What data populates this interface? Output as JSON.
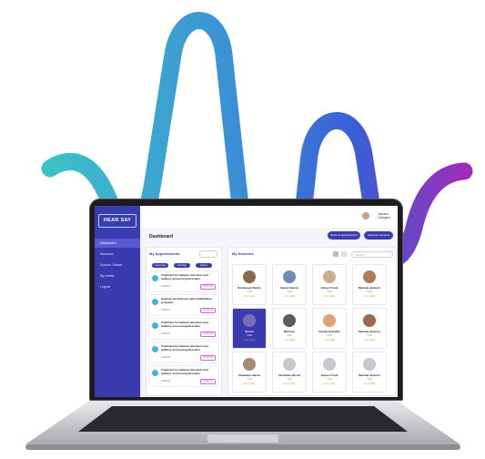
{
  "brand": {
    "logo": "HEAR SAY"
  },
  "sidebar": {
    "items": [
      "Dashboard",
      "Sessions",
      "Speech Trainer",
      "My profile",
      "Logout"
    ]
  },
  "header": {
    "title": "Dashboard",
    "user_name": "Jackson",
    "user_role": "Caregiver"
  },
  "actions": {
    "book": "Book an appointment",
    "add": "Add new account"
  },
  "appointments": {
    "title": "My Appointments",
    "tabs": [
      "Upcoming",
      "Pending",
      "History"
    ],
    "items": [
      {
        "text": "Treatment for balance disorders and auditory processing disorders",
        "date": "01/05/23",
        "status": "Confirmed"
      },
      {
        "text": "Hearing aid dispense and rehabilitation programs",
        "date": "01/05/23",
        "status": "Confirmed"
      },
      {
        "text": "Treatment for balance disorders and auditory processing disorders",
        "date": "01/05/23",
        "status": "Confirmed"
      },
      {
        "text": "Treatment for balance disorders and auditory processing disorders",
        "date": "01/05/23",
        "status": "Confirmed"
      },
      {
        "text": "Treatment for balance disorders and auditory processing disorders",
        "date": "01/05/23",
        "status": "Confirmed"
      }
    ]
  },
  "students": {
    "title": "My Students",
    "search_placeholder": "Search",
    "cards": [
      {
        "name": "Emmanuel Okafor",
        "sub": "Child",
        "link": "View details"
      },
      {
        "name": "Daniel Garcia",
        "sub": "Child",
        "link": "View details"
      },
      {
        "name": "Steven Frank",
        "sub": "Child",
        "link": "View details"
      },
      {
        "name": "Melinda Jackson",
        "sub": "Child",
        "link": "View details"
      },
      {
        "name": "Steven",
        "sub": "Child",
        "link": "View details"
      },
      {
        "name": "Martinez",
        "sub": "Child",
        "link": "View details"
      },
      {
        "name": "Amelia Gabrielle",
        "sub": "Child",
        "link": "View details"
      },
      {
        "name": "Melinda Jackson",
        "sub": "Child",
        "link": "View details"
      },
      {
        "name": "Abubakar Hamza",
        "sub": "Child",
        "link": "View details"
      },
      {
        "name": "Alexander Bloom",
        "sub": "Child",
        "link": "View details"
      },
      {
        "name": "Steven Frank",
        "sub": "Child",
        "link": "View details"
      },
      {
        "name": "Melinda Jackson",
        "sub": "Child",
        "link": "View details"
      }
    ]
  },
  "colors": {
    "brand": "#3b3bb0",
    "accent": "#c13fc4",
    "wave_start": "#3cc1c8",
    "wave_end": "#a02db7",
    "wave_mid": "#3b5bd6"
  }
}
